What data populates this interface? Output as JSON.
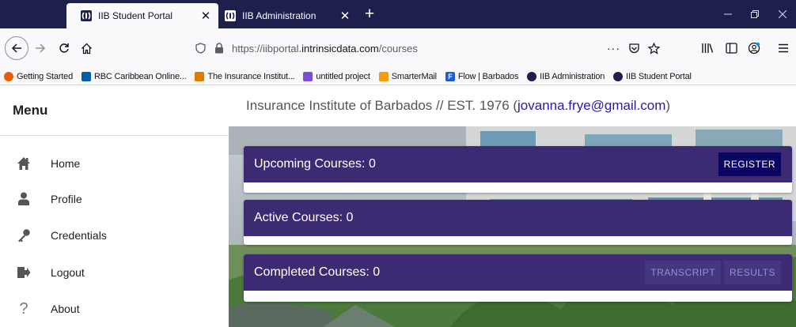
{
  "browser": {
    "tabs": [
      {
        "title": "IIB Student Portal",
        "active": true
      },
      {
        "title": "IIB Administration",
        "active": false
      }
    ],
    "url": {
      "prefix": "https://iibportal.",
      "domain": "intrinsicdata.com",
      "path": "/courses"
    },
    "bookmarks": [
      {
        "label": "Getting Started",
        "icon": "firefox-icon",
        "color": "#e66000"
      },
      {
        "label": "RBC Caribbean Online...",
        "icon": "rbc-icon",
        "color": "#005daa"
      },
      {
        "label": "The Insurance Institut...",
        "icon": "insurance-institute-icon",
        "color": "#e07b00"
      },
      {
        "label": "untitled project",
        "icon": "project-icon",
        "color": "#7b4fd1"
      },
      {
        "label": "SmarterMail",
        "icon": "mail-icon",
        "color": "#f39c12"
      },
      {
        "label": "Flow | Barbados",
        "icon": "flow-icon",
        "color": "#1e5bd8"
      },
      {
        "label": "IIB Administration",
        "icon": "iib-icon",
        "color": "#1d1f4d"
      },
      {
        "label": "IIB Student Portal",
        "icon": "iib-icon",
        "color": "#1d1f4d"
      }
    ]
  },
  "sidebar": {
    "title": "Menu",
    "items": [
      {
        "label": "Home",
        "icon": "home-icon"
      },
      {
        "label": "Profile",
        "icon": "user-icon"
      },
      {
        "label": "Credentials",
        "icon": "key-icon"
      },
      {
        "label": "Logout",
        "icon": "logout-icon"
      },
      {
        "label": "About",
        "icon": "question-icon"
      }
    ]
  },
  "header": {
    "text": "Insurance Institute of Barbados // EST. 1976 (",
    "email": "jovanna.frye@gmail.com",
    "close": ")"
  },
  "cards": [
    {
      "title": "Upcoming Courses: 0",
      "buttons": [
        {
          "label": "REGISTER"
        }
      ]
    },
    {
      "title": "Active Courses: 0",
      "buttons": []
    },
    {
      "title": "Completed Courses: 0",
      "buttons": [
        {
          "label": "TRANSCRIPT"
        },
        {
          "label": "RESULTS"
        }
      ]
    }
  ],
  "colors": {
    "tabstrip": "#1d1f4d",
    "card_header": "#3c2b73",
    "primary_button": "#0c0663",
    "email_link": "#2a1aa1"
  }
}
